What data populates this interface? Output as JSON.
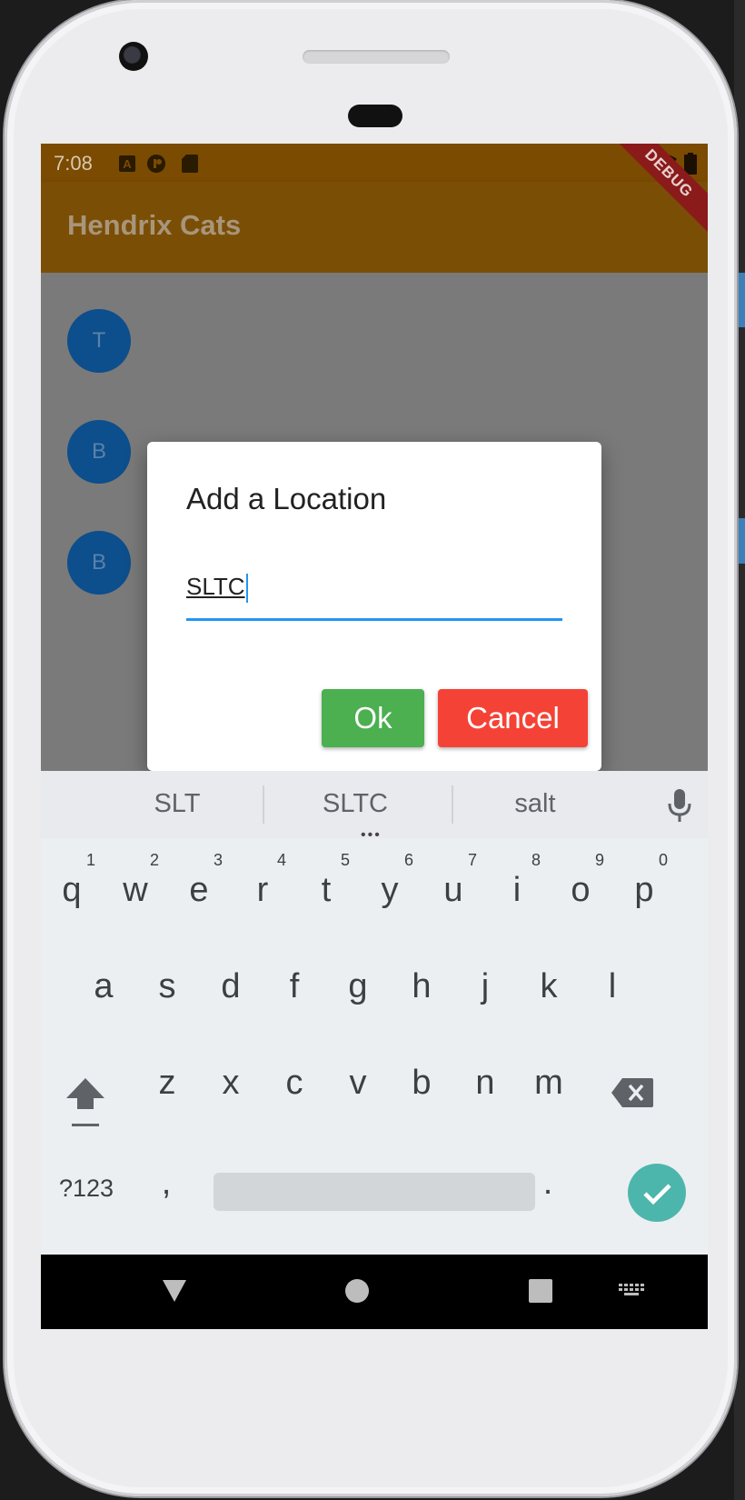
{
  "status_bar": {
    "time": "7:08",
    "icons": [
      "a-notification-icon",
      "flutter-notification-icon",
      "sd-card-icon",
      "wifi-icon",
      "battery-icon"
    ]
  },
  "debug_banner": "DEBUG",
  "app_bar": {
    "title": "Hendrix Cats"
  },
  "list": {
    "avatars": [
      "T",
      "B",
      "B"
    ]
  },
  "fab": {
    "icon": "plus-icon",
    "label": "+"
  },
  "dialog": {
    "title": "Add a Location",
    "input_value": "SLTC",
    "ok_label": "Ok",
    "cancel_label": "Cancel"
  },
  "suggestions": [
    "SLT",
    "SLTC",
    "salt"
  ],
  "keyboard": {
    "row1": [
      "q",
      "w",
      "e",
      "r",
      "t",
      "y",
      "u",
      "i",
      "o",
      "p"
    ],
    "row1_hints": [
      "1",
      "2",
      "3",
      "4",
      "5",
      "6",
      "7",
      "8",
      "9",
      "0"
    ],
    "row2": [
      "a",
      "s",
      "d",
      "f",
      "g",
      "h",
      "j",
      "k",
      "l"
    ],
    "row3": [
      "z",
      "x",
      "c",
      "v",
      "b",
      "n",
      "m"
    ],
    "symbols_key": "?123",
    "comma_key": ",",
    "period_key": "."
  },
  "colors": {
    "status_bar": "#7a4b00",
    "app_bar": "#7a4f05",
    "avatar": "#0d4e8c",
    "ok_button": "#4caf50",
    "cancel_button": "#f44336",
    "input_underline": "#2196f3",
    "enter_key": "#4db6ac"
  }
}
